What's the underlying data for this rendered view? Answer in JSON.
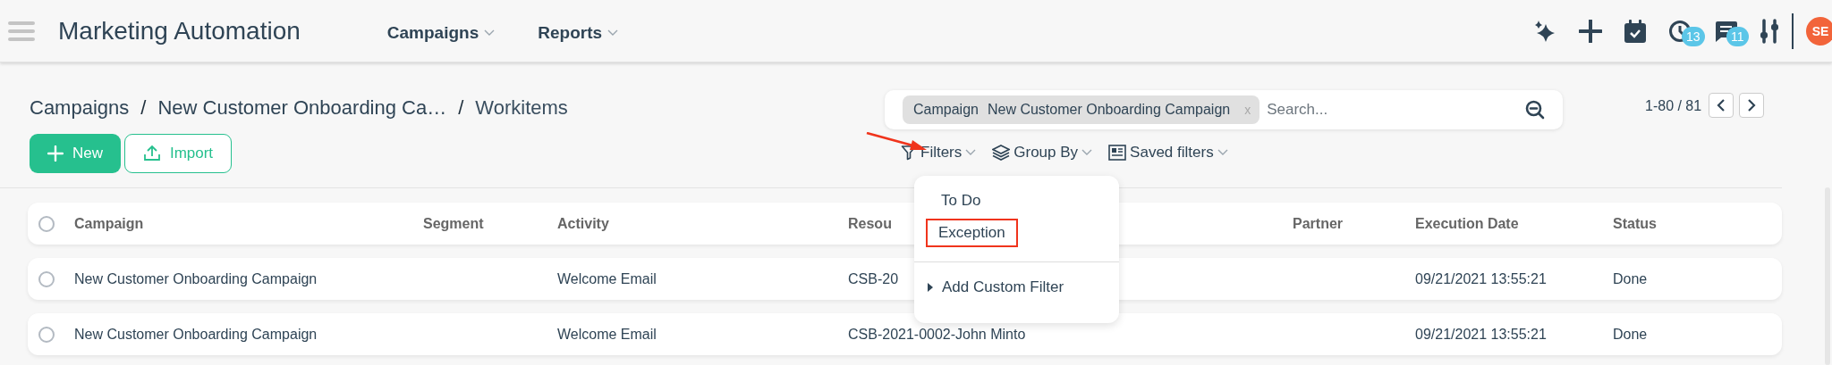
{
  "app": {
    "title": "Marketing Automation"
  },
  "nav": [
    {
      "label": "Campaigns"
    },
    {
      "label": "Reports"
    }
  ],
  "header_badges": {
    "activities": "13",
    "messages": "11"
  },
  "avatar": {
    "initials": "SE"
  },
  "breadcrumb": [
    {
      "kind": "link",
      "text": "Campaigns"
    },
    {
      "kind": "separator",
      "text": "/"
    },
    {
      "kind": "link",
      "text": "New Customer Onboarding Ca…"
    },
    {
      "kind": "separator",
      "text": "/"
    },
    {
      "kind": "current",
      "text": "Workitems"
    }
  ],
  "buttons": {
    "new": "New",
    "import": "Import"
  },
  "search": {
    "facet": {
      "label": "Campaign",
      "value": "New Customer Onboarding Campaign",
      "remove": "x"
    },
    "placeholder": "Search..."
  },
  "pager": {
    "range": "1-80 / 81"
  },
  "filter_bar": [
    "Filters",
    "Group By",
    "Saved filters"
  ],
  "filter_menu": {
    "items": [
      {
        "label": "To Do",
        "highlighted": false
      },
      {
        "label": "Exception",
        "highlighted": true
      }
    ],
    "custom": "Add Custom Filter"
  },
  "table": {
    "checked": false,
    "columns": [
      "Campaign",
      "Segment",
      "Activity",
      "Resou",
      "Partner",
      "Execution Date",
      "Status"
    ],
    "rows": [
      {
        "checked": false,
        "campaign": "New Customer Onboarding Campaign",
        "activity": "Welcome Email",
        "resource": "CSB-20",
        "execution_date": "09/21/2021 13:55:21",
        "status": "Done"
      },
      {
        "checked": false,
        "campaign": "New Customer Onboarding Campaign",
        "activity": "Welcome Email",
        "resource": "CSB-2021-0002-John Minto",
        "execution_date": "09/21/2021 13:55:21",
        "status": "Done"
      }
    ]
  }
}
